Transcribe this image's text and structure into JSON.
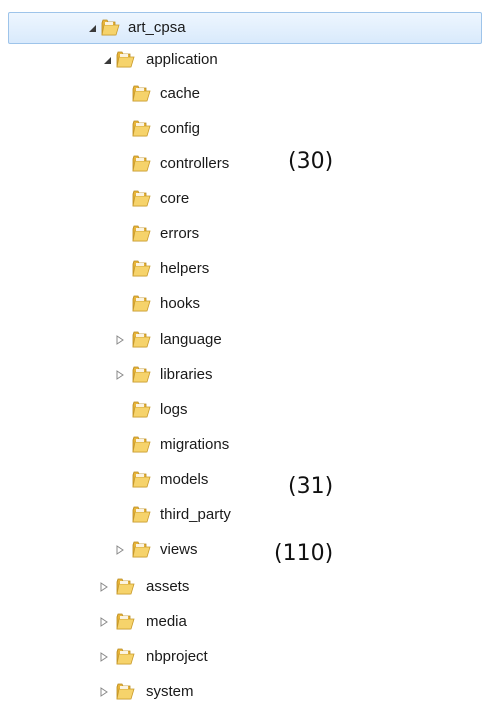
{
  "tree": {
    "root": {
      "label": "art_cpsa",
      "state": "expanded",
      "selected": true
    },
    "application": {
      "label": "application",
      "state": "expanded"
    },
    "application_children": [
      {
        "label": "cache",
        "state": "none"
      },
      {
        "label": "config",
        "state": "none"
      },
      {
        "label": "controllers",
        "state": "none"
      },
      {
        "label": "core",
        "state": "none"
      },
      {
        "label": "errors",
        "state": "none"
      },
      {
        "label": "helpers",
        "state": "none"
      },
      {
        "label": "hooks",
        "state": "none"
      },
      {
        "label": "language",
        "state": "collapsed"
      },
      {
        "label": "libraries",
        "state": "collapsed"
      },
      {
        "label": "logs",
        "state": "none"
      },
      {
        "label": "migrations",
        "state": "none"
      },
      {
        "label": "models",
        "state": "none"
      },
      {
        "label": "third_party",
        "state": "none"
      },
      {
        "label": "views",
        "state": "collapsed"
      }
    ],
    "root_children": [
      {
        "label": "assets",
        "state": "collapsed"
      },
      {
        "label": "media",
        "state": "collapsed"
      },
      {
        "label": "nbproject",
        "state": "collapsed"
      },
      {
        "label": "system",
        "state": "collapsed"
      }
    ]
  },
  "annotations": {
    "controllers_count": "(30)",
    "models_count": "(31)",
    "views_count": "(110)"
  },
  "colors": {
    "selection_border": "#9ec4ea",
    "selection_fill": "#d9eafc",
    "folder_yellow": "#f2c94c"
  },
  "icons": {
    "folder": "folder-icon",
    "expanded": "triangle-expanded-icon",
    "collapsed": "triangle-collapsed-icon"
  }
}
